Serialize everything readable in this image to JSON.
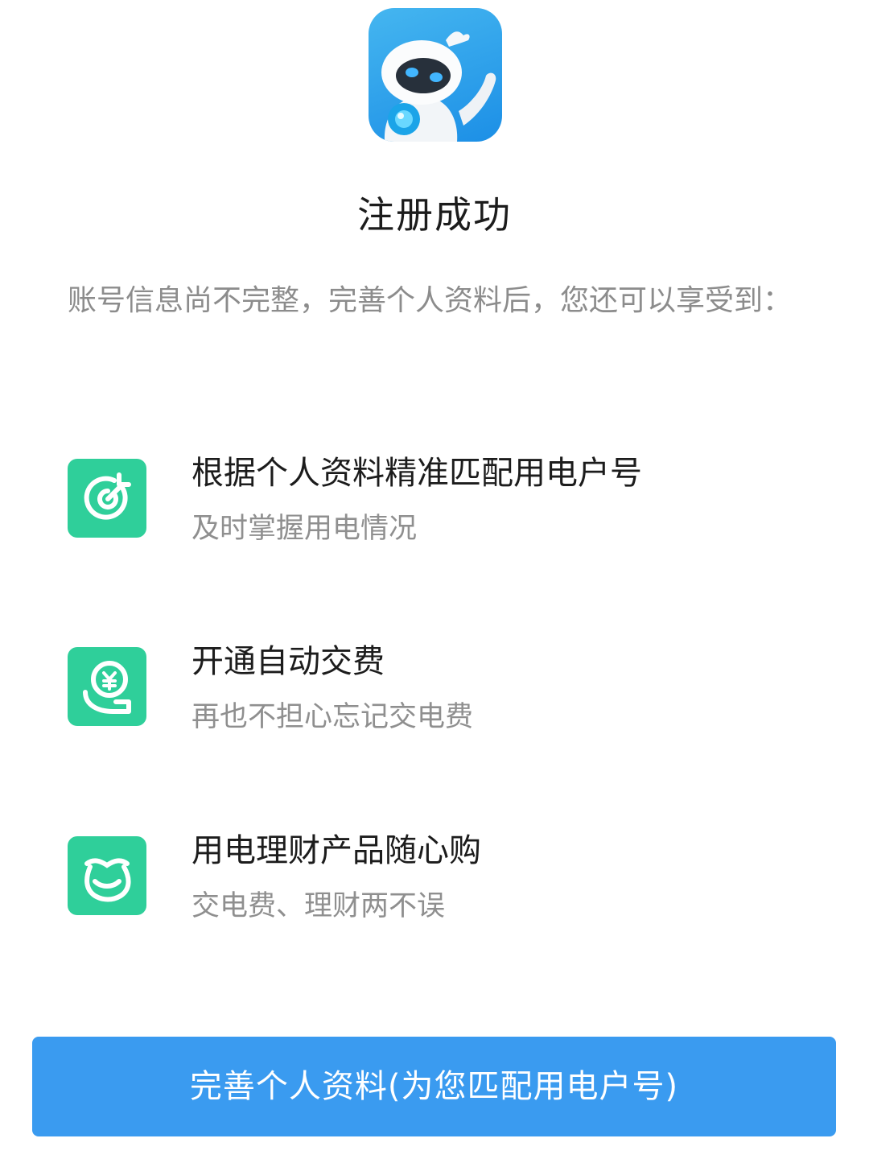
{
  "header": {
    "logo_icon": "robot-mascot-icon",
    "title": "注册成功"
  },
  "intro": {
    "text": "账号信息尚不完整，完善个人资料后，您还可以享受到："
  },
  "benefits": [
    {
      "icon": "target-icon",
      "title": "根据个人资料精准匹配用电户号",
      "desc": "及时掌握用电情况"
    },
    {
      "icon": "coin-hand-icon",
      "title": "开通自动交费",
      "desc": "再也不担心忘记交电费"
    },
    {
      "icon": "money-bag-icon",
      "title": "用电理财产品随心购",
      "desc": "交电费、理财两不误"
    }
  ],
  "cta": {
    "label": "完善个人资料(为您匹配用电户号)"
  },
  "colors": {
    "accent_green": "#2fcf9a",
    "button_blue": "#3a9bf0",
    "logo_blue": "#1c8fe6"
  }
}
